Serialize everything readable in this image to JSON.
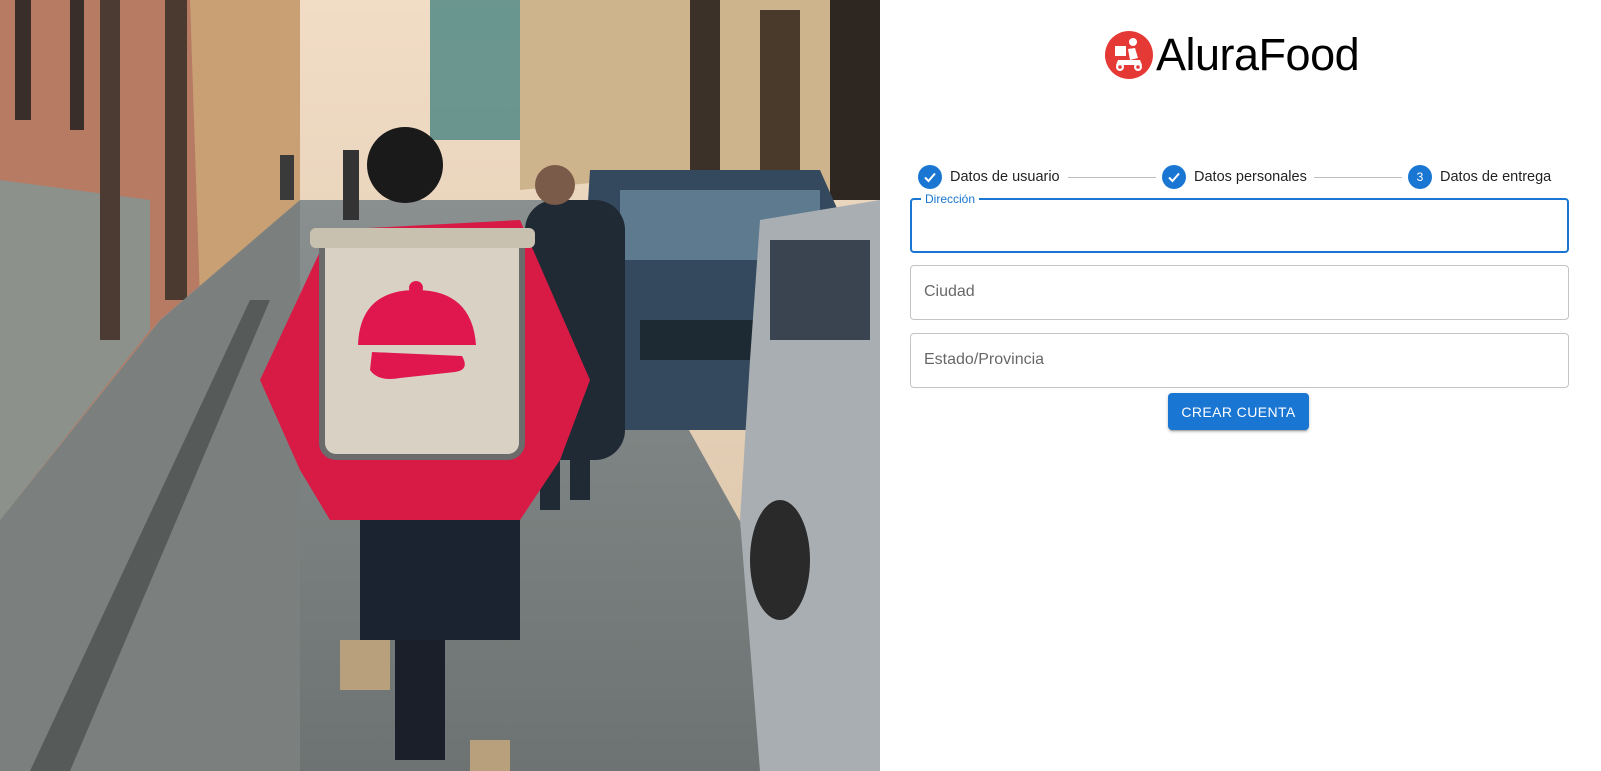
{
  "brand": {
    "name": "AluraFood",
    "logo_icon": "delivery-scooter-icon",
    "logo_color": "#e53935"
  },
  "stepper": {
    "steps": [
      {
        "label": "Datos de usuario",
        "state": "completed",
        "icon": "check-icon"
      },
      {
        "label": "Datos personales",
        "state": "completed",
        "icon": "check-icon"
      },
      {
        "label": "Datos de entrega",
        "state": "active",
        "number": "3"
      }
    ]
  },
  "form": {
    "fields": [
      {
        "label": "Dirección",
        "value": "",
        "state": "focused"
      },
      {
        "label": "Ciudad",
        "value": ""
      },
      {
        "label": "Estado/Provincia",
        "value": ""
      }
    ],
    "submit_label": "CREAR CUENTA"
  },
  "colors": {
    "primary": "#1976d2",
    "brand_red": "#e53935",
    "backpack_pink": "#e0174f"
  }
}
